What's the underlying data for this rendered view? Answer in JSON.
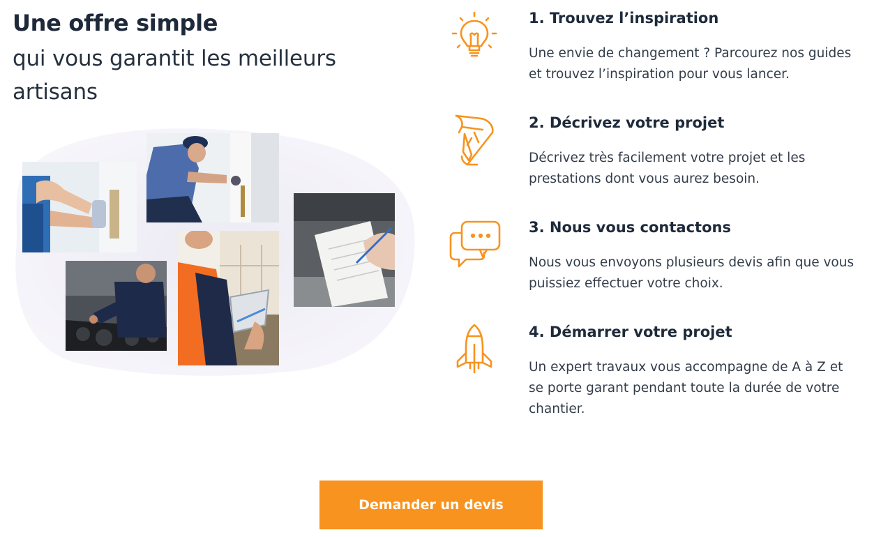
{
  "header": {
    "title": "Une offre simple",
    "subtitle": "qui vous garantit les meilleurs artisans"
  },
  "collage": {
    "photos": [
      "plasterer-photo",
      "plumber-photo",
      "clipboard-photo",
      "mechanic-photo",
      "site-worker-tablet-photo"
    ]
  },
  "steps": [
    {
      "icon": "lightbulb-icon",
      "title": "1. Trouvez l’inspiration",
      "text": "Une envie de changement ? Parcourez nos guides et trouvez l’inspiration pour vous lancer."
    },
    {
      "icon": "pencil-paper-icon",
      "title": "2. Décrivez votre projet",
      "text": "Décrivez très facilement votre projet et les prestations dont vous aurez besoin."
    },
    {
      "icon": "chat-bubbles-icon",
      "title": "3. Nous vous contactons",
      "text": "Nous vous envoyons plusieurs devis afin que vous puissiez effectuer votre choix."
    },
    {
      "icon": "rocket-icon",
      "title": "4. Démarrer votre projet",
      "text": "Un expert travaux vous accompagne de A à Z et se porte garant pendant toute la durée de votre chantier."
    }
  ],
  "cta": {
    "label": "Demander un devis"
  },
  "colors": {
    "accent": "#f7931e",
    "heading": "#1e2a3a",
    "text": "#333d4a"
  }
}
